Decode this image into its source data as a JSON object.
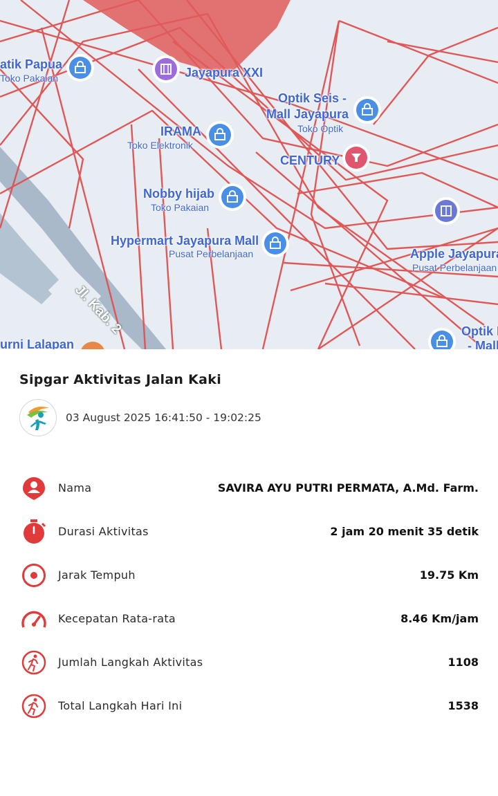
{
  "map": {
    "pois": [
      {
        "name": "atik Papua",
        "sub": "Toko Pakaian"
      },
      {
        "name": "Jayapura XXI",
        "sub": ""
      },
      {
        "name": "Optik Seis -",
        "sub": "Toko Optik",
        "name2": "Mall Jayapura"
      },
      {
        "name": "IRAMA",
        "sub": "Toko Elektronik"
      },
      {
        "name": "CENTURY",
        "sub": ""
      },
      {
        "name": "Nobby hijab",
        "sub": "Toko Pakaian"
      },
      {
        "name": "Hypermart Jayapura Mall",
        "sub": "Pusat Perbelanjaan"
      },
      {
        "name": "Apple Jayapura",
        "sub": "Pusat Perbelanjaan"
      },
      {
        "name": "Optik I",
        "sub": "",
        "name2": "- Mall"
      },
      {
        "name": "urni Lalapan",
        "sub": ""
      }
    ],
    "road_label": "Jl. Kab. 2",
    "track_color": "#e05050",
    "shop_pin_color": "#4a8fe6",
    "cinema_pin_color": "#9a6cdc",
    "century_pin_color": "#e0566e"
  },
  "card": {
    "title": "Sipgar Aktivitas Jalan Kaki",
    "date_range": "03 August 2025 16:41:50 - 19:02:25",
    "accent_color": "#e03a3a",
    "rows": [
      {
        "icon": "person-pin-icon",
        "label": "Nama",
        "value": "SAVIRA AYU PUTRI PERMATA, A.Md. Farm."
      },
      {
        "icon": "stopwatch-icon",
        "label": "Durasi Aktivitas",
        "value": "2 jam 20 menit 35 detik"
      },
      {
        "icon": "target-icon",
        "label": "Jarak Tempuh",
        "value": "19.75 Km"
      },
      {
        "icon": "speedometer-icon",
        "label": "Kecepatan Rata-rata",
        "value": "8.46 Km/jam"
      },
      {
        "icon": "walking-icon",
        "label": "Jumlah Langkah Aktivitas",
        "value": "1108"
      },
      {
        "icon": "walking-icon",
        "label": "Total Langkah Hari Ini",
        "value": "1538"
      }
    ]
  }
}
